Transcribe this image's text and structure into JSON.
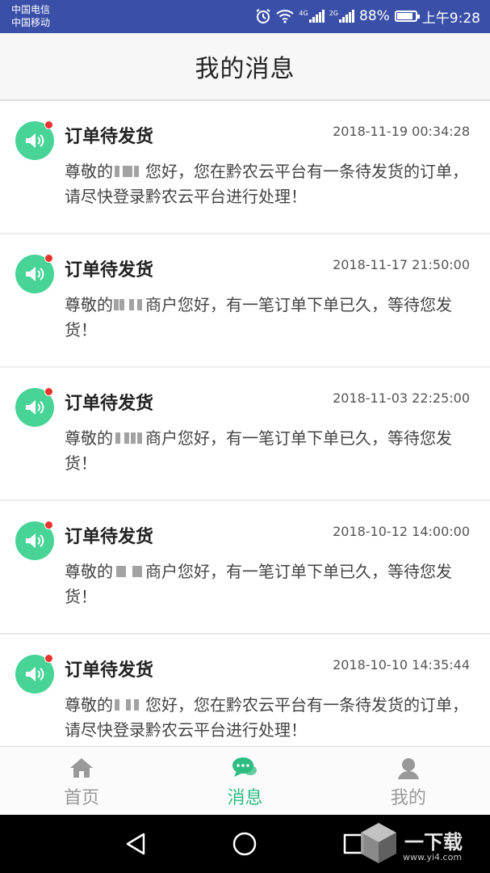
{
  "status_bar": {
    "carrier1": "中国电信",
    "carrier2": "中国移动",
    "network1": "4G",
    "network2": "2G",
    "battery": "88%",
    "battery_level": 0.88,
    "time": "上午9:28",
    "icons": [
      "alarm-icon",
      "wifi-icon",
      "signal-icon",
      "battery-icon"
    ]
  },
  "header": {
    "title": "我的消息"
  },
  "messages": [
    {
      "title": "订单待发货",
      "time": "2018-11-19 00:34:28",
      "body_pre": "尊敬的",
      "body_post": "您好，您在黔农云平台有一条待发货的订单，请尽快登录黔农云平台进行处理！",
      "unread": true
    },
    {
      "title": "订单待发货",
      "time": "2018-11-17 21:50:00",
      "body_pre": "尊敬的",
      "body_post": "商户您好，有一笔订单下单已久，等待您发货！",
      "unread": true
    },
    {
      "title": "订单待发货",
      "time": "2018-11-03 22:25:00",
      "body_pre": "尊敬的",
      "body_post": "商户您好，有一笔订单下单已久，等待您发货！",
      "unread": true
    },
    {
      "title": "订单待发货",
      "time": "2018-10-12 14:00:00",
      "body_pre": "尊敬的",
      "body_post": "商户您好，有一笔订单下单已久，等待您发货！",
      "unread": true
    },
    {
      "title": "订单待发货",
      "time": "2018-10-10 14:35:44",
      "body_pre": "尊敬的",
      "body_post": "您好，您在黔农云平台有一条待发货的订单，请尽快登录黔农云平台进行处理！",
      "unread": true
    }
  ],
  "tabs": [
    {
      "label": "首页",
      "icon": "home-icon",
      "active": false
    },
    {
      "label": "消息",
      "icon": "chat-icon",
      "active": true
    },
    {
      "label": "我的",
      "icon": "user-icon",
      "active": false
    }
  ],
  "colors": {
    "status_bar": "#3a4fa8",
    "accent": "#2dbd82",
    "avatar": "#48d496",
    "unread_dot": "#e8342f",
    "tab_inactive": "#999999"
  },
  "watermark": {
    "text": "一下载",
    "url": "www.yi4.com"
  }
}
